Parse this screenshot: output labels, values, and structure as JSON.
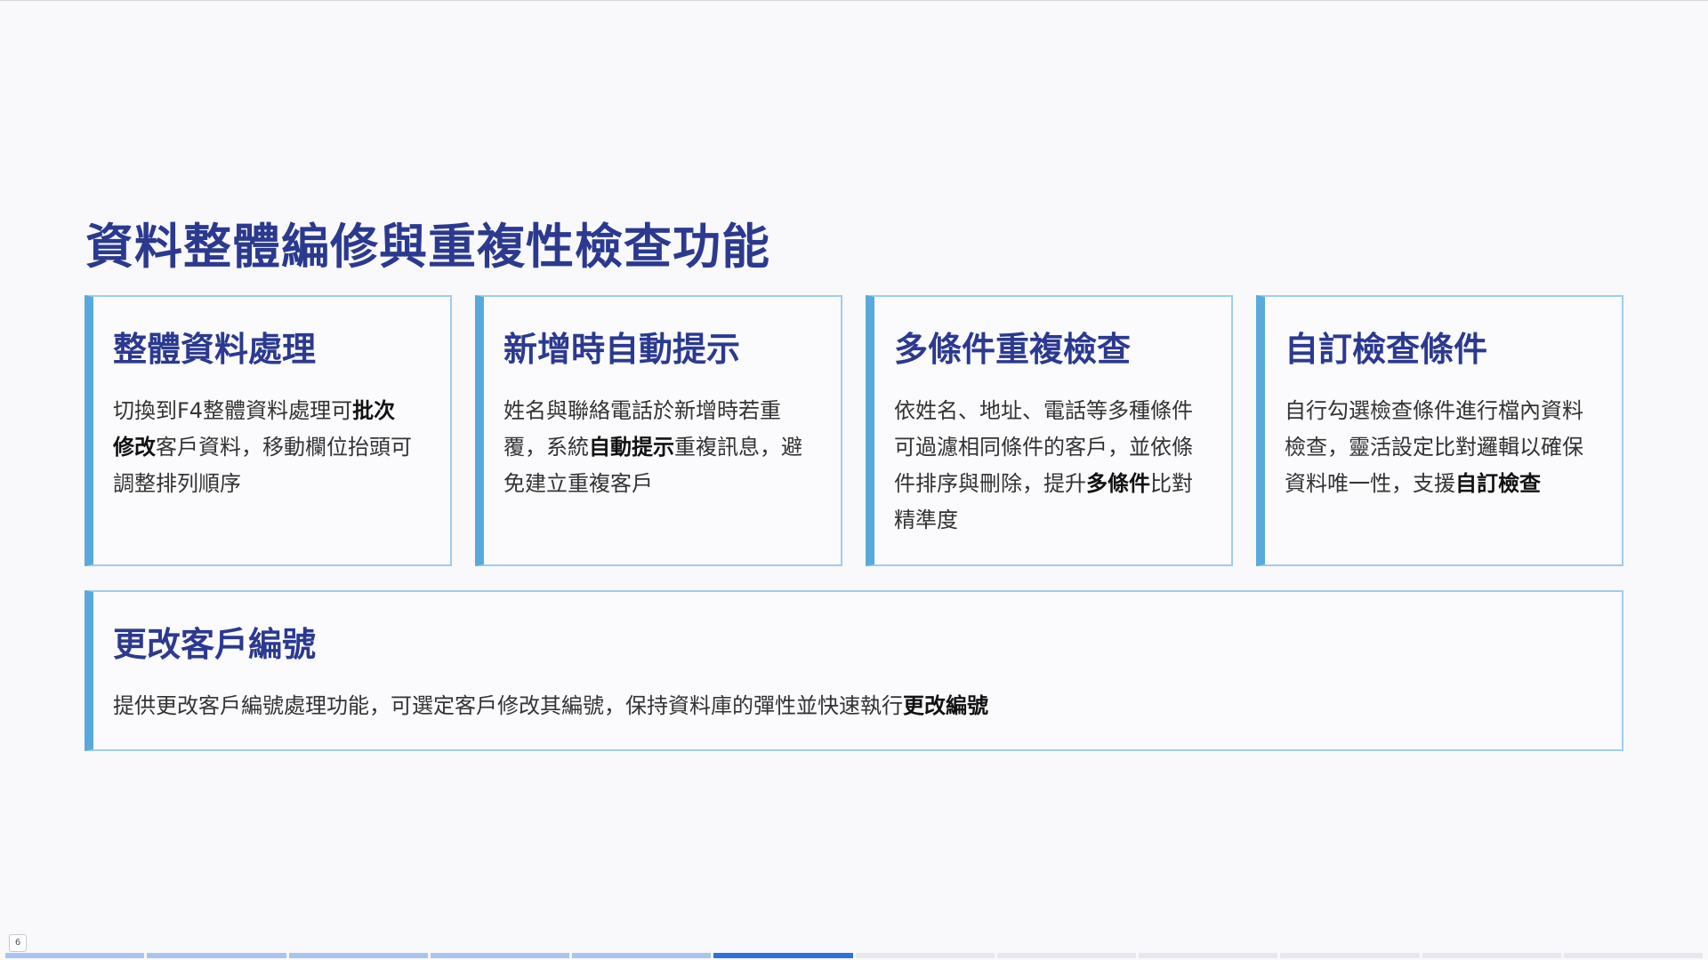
{
  "slide": {
    "title": "資料整體編修與重複性檢查功能",
    "page_number": "6",
    "progress": {
      "total_segments": 12,
      "current_index": 5
    }
  },
  "cards": [
    {
      "title": "整體資料處理",
      "body": [
        {
          "text": "切換到F4整體資料處理可",
          "bold": false
        },
        {
          "text": "批次修改",
          "bold": true
        },
        {
          "text": "客戶資料，移動欄位抬頭可調整排列順序",
          "bold": false
        }
      ]
    },
    {
      "title": "新增時自動提示",
      "body": [
        {
          "text": "姓名與聯絡電話於新增時若重覆，系統",
          "bold": false
        },
        {
          "text": "自動提示",
          "bold": true
        },
        {
          "text": "重複訊息，避免建立重複客戶",
          "bold": false
        }
      ]
    },
    {
      "title": "多條件重複檢查",
      "body": [
        {
          "text": "依姓名、地址、電話等多種條件可過濾相同條件的客戶，並依條件排序與刪除，提升",
          "bold": false
        },
        {
          "text": "多條件",
          "bold": true
        },
        {
          "text": "比對精準度",
          "bold": false
        }
      ]
    },
    {
      "title": "自訂檢查條件",
      "body": [
        {
          "text": "自行勾選檢查條件進行檔內資料檢查，靈活設定比對邏輯以確保資料唯一性，支援",
          "bold": false
        },
        {
          "text": "自訂檢查",
          "bold": true
        }
      ]
    }
  ],
  "wide_card": {
    "title": "更改客戶編號",
    "body": [
      {
        "text": "提供更改客戶編號處理功能，可選定客戶修改其編號，保持資料庫的彈性並快速執行",
        "bold": false
      },
      {
        "text": "更改編號",
        "bold": true
      }
    ]
  },
  "colors": {
    "title": "#2b3a8f",
    "accent_bar": "#5aa9dc",
    "card_border": "#9fcde9",
    "progress_current": "#2f6fde",
    "progress_done": "#a9c4ee"
  }
}
